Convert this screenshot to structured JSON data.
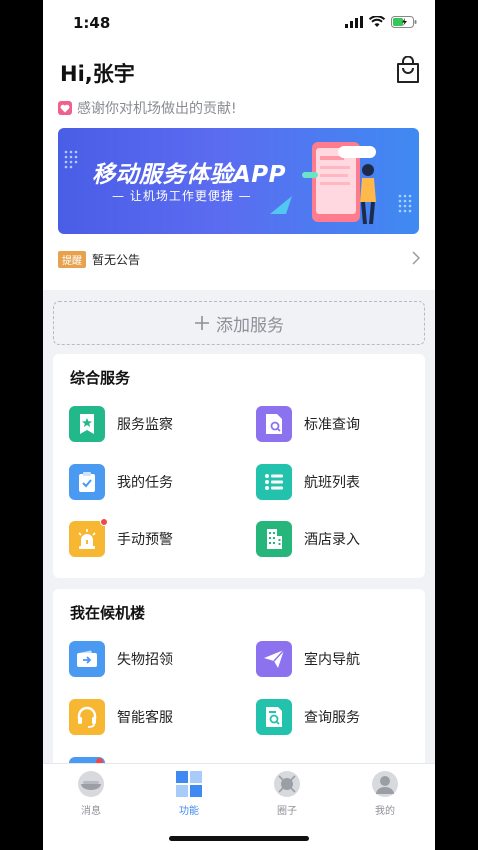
{
  "status": {
    "time": "1:48"
  },
  "header": {
    "greeting": "Hi,张宇",
    "thanks": "感谢你对机场做出的贡献!"
  },
  "banner": {
    "title": "移动服务体验APP",
    "subtitle": "— 让机场工作更便捷 —"
  },
  "notice": {
    "tag": "提醒",
    "text": "暂无公告"
  },
  "add_service": {
    "label": "添加服务"
  },
  "sections": [
    {
      "title": "综合服务",
      "items": [
        {
          "label": "服务监察",
          "icon": "ticket-star-icon",
          "color": "#22b889"
        },
        {
          "label": "标准查询",
          "icon": "document-search-icon",
          "color": "#8d72f0"
        },
        {
          "label": "我的任务",
          "icon": "clipboard-check-icon",
          "color": "#4a9af2"
        },
        {
          "label": "航班列表",
          "icon": "list-icon",
          "color": "#22c2ad"
        },
        {
          "label": "手动预警",
          "icon": "alarm-icon",
          "color": "#f7b733"
        },
        {
          "label": "酒店录入",
          "icon": "building-icon",
          "color": "#26b57a"
        }
      ]
    },
    {
      "title": "我在候机楼",
      "items": [
        {
          "label": "失物招领",
          "icon": "wallet-icon",
          "color": "#4a9af2"
        },
        {
          "label": "室内导航",
          "icon": "paper-plane-icon",
          "color": "#8d72f0"
        },
        {
          "label": "智能客服",
          "icon": "headset-icon",
          "color": "#f7b733"
        },
        {
          "label": "查询服务",
          "icon": "search-doc-icon",
          "color": "#22c2ad"
        }
      ]
    }
  ],
  "tabs": [
    {
      "label": "消息",
      "icon": "message-icon"
    },
    {
      "label": "功能",
      "icon": "grid-icon",
      "active": true
    },
    {
      "label": "圈子",
      "icon": "circle-icon"
    },
    {
      "label": "我的",
      "icon": "user-icon"
    }
  ],
  "colors": {
    "accent": "#3f8af2",
    "background": "#f1f2f6"
  }
}
